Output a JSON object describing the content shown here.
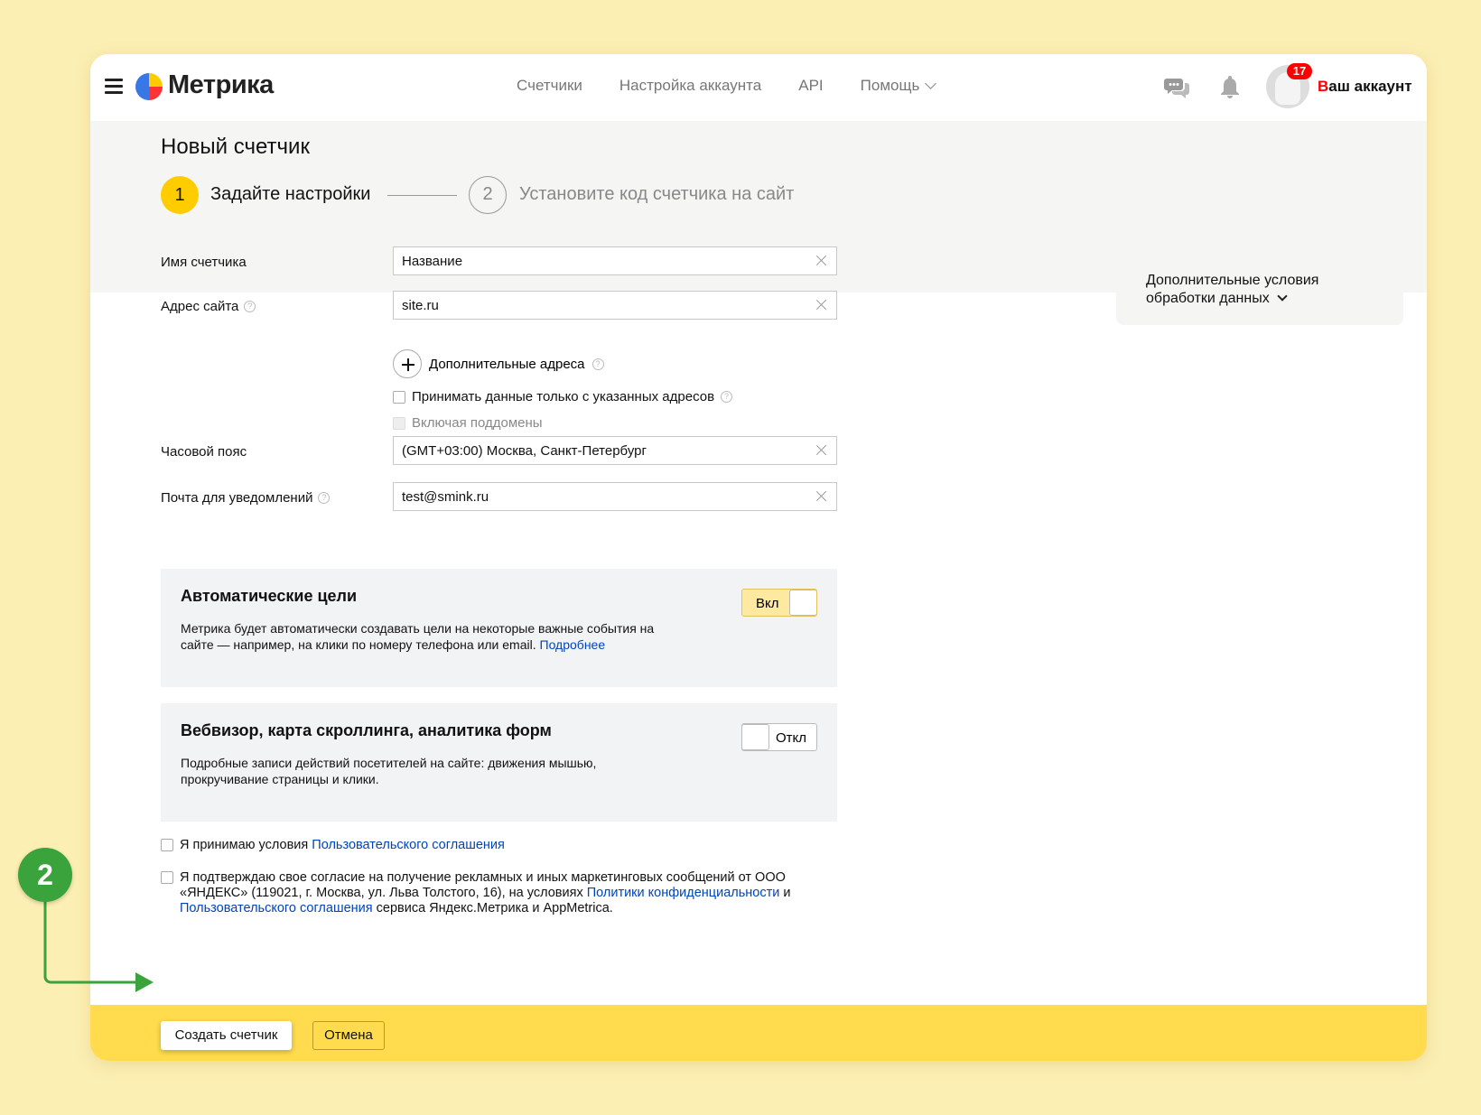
{
  "header": {
    "logo": "Метрика",
    "nav": [
      "Счетчики",
      "Настройка аккаунта",
      "API",
      "Помощь"
    ],
    "badge_count": "17",
    "account_first_letter": "В",
    "account_rest": "аш аккаунт"
  },
  "page": {
    "title": "Новый счетчик",
    "step1_number": "1",
    "step1_label": "Задайте настройки",
    "step2_number": "2",
    "step2_label": "Установите код счетчика на сайт"
  },
  "form": {
    "name_label": "Имя счетчика",
    "name_value": "Название",
    "site_label": "Адрес сайта",
    "site_value": "site.ru",
    "add_addresses": "Дополнительные адреса",
    "only_specified": "Принимать данные только с указанных адресов",
    "include_subdomains": "Включая поддомены",
    "timezone_label": "Часовой пояс",
    "timezone_value": "(GMT+03:00) Москва, Санкт-Петербург",
    "email_label": "Почта для уведомлений",
    "email_value": "test@smink.ru"
  },
  "side_panel": {
    "line1": "Дополнительные условия",
    "line2": "обработки данных"
  },
  "auto_goals": {
    "title": "Автоматические цели",
    "text": "Метрика будет автоматически создавать цели на некоторые важные события на сайте — например, на клики по номеру телефона или email. ",
    "link": "Подробнее",
    "toggle": "Вкл"
  },
  "webvisor": {
    "title": "Вебвизор, карта скроллинга, аналитика форм",
    "text": "Подробные записи действий посетителей на сайте: движения мышью, прокручивание страницы и клики.",
    "toggle": "Откл"
  },
  "consent": {
    "terms_prefix": "Я принимаю условия ",
    "terms_link": "Пользовательского соглашения",
    "ads_text": "Я подтверждаю свое согласие на получение рекламных и иных маркетинговых сообщений от ООО «ЯНДЕКС» (119021, г. Москва, ул. Льва Толстого, 16), на условиях ",
    "privacy_link": "Политики конфиденциальности",
    "and": " и ",
    "terms_link2": "Пользовательского соглашения",
    "ads_suffix": " сервиса Яндекс.Метрика и AppMetrica."
  },
  "footer": {
    "create": "Создать счетчик",
    "cancel": "Отмена"
  },
  "annotation": {
    "marker": "2"
  },
  "colors": {
    "accent_yellow": "#ffdb4d",
    "step_yellow": "#ffcc00",
    "link_blue": "#0044bb",
    "marker_green": "#3ba33b",
    "background": "#fcefb3"
  }
}
